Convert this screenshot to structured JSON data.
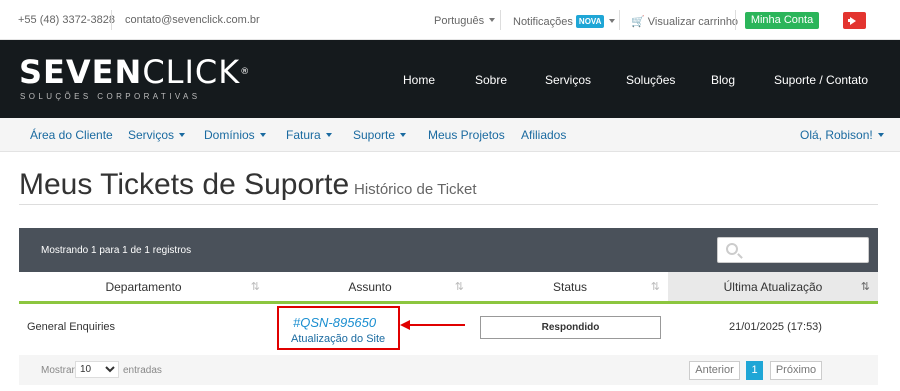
{
  "topbar": {
    "phone": "+55 (48) 3372-3828",
    "email": "contato@sevenclick.com.br",
    "language": "Português",
    "notifications": "Notificações",
    "notifications_badge": "NOVA",
    "cart": "Visualizar carrinho",
    "account_button": "Minha Conta"
  },
  "header": {
    "logo_bold": "SEVEN",
    "logo_light": "CLICK",
    "logo_reg": "®",
    "logo_tagline": "SOLUÇÕES CORPORATIVAS",
    "nav": [
      "Home",
      "Sobre",
      "Serviços",
      "Soluções",
      "Blog",
      "Suporte / Contato"
    ]
  },
  "subnav": {
    "items": [
      "Área do Cliente",
      "Serviços",
      "Domínios",
      "Fatura",
      "Suporte",
      "Meus Projetos",
      "Afiliados"
    ],
    "user": "Olá, Robison!"
  },
  "page": {
    "title": "Meus Tickets de Suporte",
    "subtitle": "Histórico de Ticket"
  },
  "table": {
    "showing": "Mostrando 1 para 1 de 1 registros",
    "search_placeholder": "",
    "columns": [
      "Departamento",
      "Assunto",
      "Status",
      "Última Atualização"
    ],
    "rows": [
      {
        "department": "General Enquiries",
        "ticket_id": "#QSN-895650",
        "subject": "Atualização do Site",
        "status": "Respondido",
        "updated": "21/01/2025 (17:53)"
      }
    ]
  },
  "footer": {
    "show_label": "Mostrar",
    "show_value": "10",
    "entries_label": "entradas",
    "prev": "Anterior",
    "page": "1",
    "next": "Próximo"
  },
  "colors": {
    "header_bg": "#151a1d",
    "accent_green": "#2bb55a",
    "accent_blue": "#1fa6d6",
    "highlight_red": "#e00000"
  }
}
